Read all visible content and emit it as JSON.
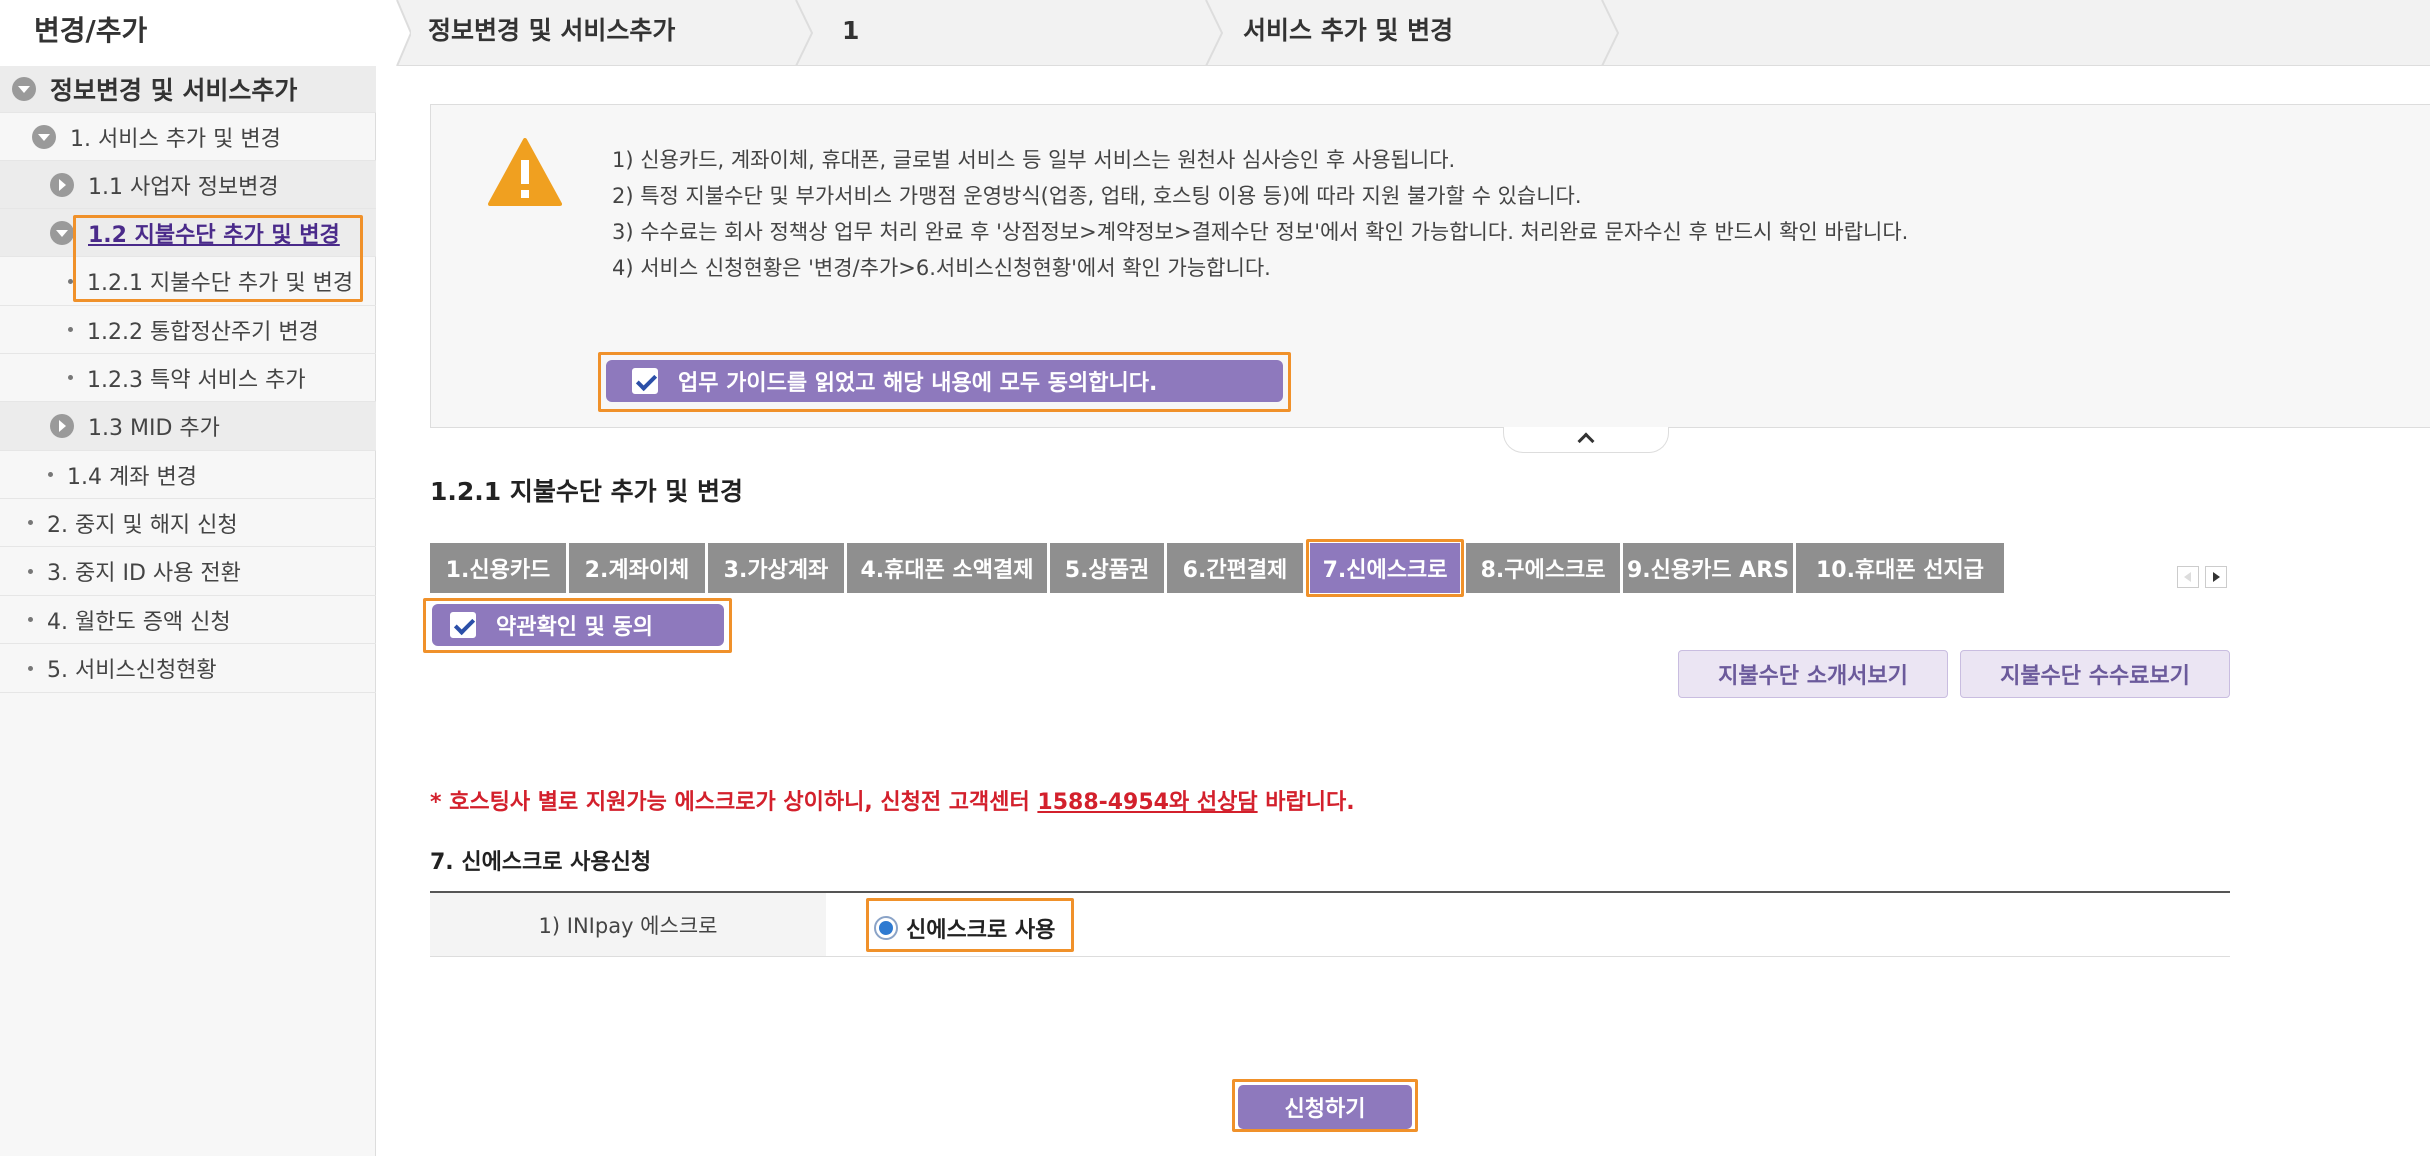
{
  "breadcrumb": {
    "root": "변경/추가",
    "level1": "정보변경 및 서비스추가",
    "level2": "1",
    "level3": "서비스 추가 및 변경"
  },
  "sidebar": {
    "header": "정보변경 및 서비스추가",
    "items": [
      {
        "label": "1. 서비스 추가 및 변경"
      },
      {
        "label": "1.1 사업자 정보변경"
      },
      {
        "label": "1.2 지불수단 추가 및 변경"
      },
      {
        "label": "1.2.1 지불수단 추가 및 변경"
      },
      {
        "label": "1.2.2 통합정산주기 변경"
      },
      {
        "label": "1.2.3 특약 서비스 추가"
      },
      {
        "label": "1.3 MID 추가"
      },
      {
        "label": "1.4 계좌 변경"
      },
      {
        "label": "2. 중지 및 해지 신청"
      },
      {
        "label": "3. 중지 ID 사용 전환"
      },
      {
        "label": "4. 월한도 증액 신청"
      },
      {
        "label": "5. 서비스신청현황"
      }
    ]
  },
  "guide": {
    "lines": [
      "1) 신용카드, 계좌이체, 휴대폰, 글로벌 서비스 등 일부 서비스는 원천사 심사승인 후 사용됩니다.",
      "2) 특정 지불수단 및 부가서비스 가맹점 운영방식(업종, 업태, 호스팅 이용 등)에 따라 지원 불가할 수 있습니다.",
      "3) 수수료는 회사 정책상 업무 처리 완료 후 '상점정보>계약정보>결제수단 정보'에서 확인 가능합니다. 처리완료 문자수신 후 반드시 확인 바랍니다.",
      "4) 서비스 신청현황은 '변경/추가>6.서비스신청현황'에서 확인 가능합니다."
    ],
    "agree_label": "업무 가이드를 읽었고 해당 내용에 모두 동의합니다."
  },
  "section_title": "1.2.1 지불수단 추가 및 변경",
  "tabs": [
    {
      "label": "1.신용카드"
    },
    {
      "label": "2.계좌이체"
    },
    {
      "label": "3.가상계좌"
    },
    {
      "label": "4.휴대폰 소액결제"
    },
    {
      "label": "5.상품권"
    },
    {
      "label": "6.간편결제"
    },
    {
      "label": "7.신에스크로"
    },
    {
      "label": "8.구에스크로"
    },
    {
      "label": "9.신용카드 ARS"
    },
    {
      "label": "10.휴대폰 선지급"
    }
  ],
  "terms_label": "약관확인 및 동의",
  "buttons": {
    "intro": "지불수단 소개서보기",
    "fee": "지불수단 수수료보기",
    "apply": "신청하기"
  },
  "notice": {
    "prefix": "* 호스팅사 별로 지원가능 에스크로가 상이하니, 신청전 고객센터 ",
    "link": "1588-4954와 선상담",
    "suffix": " 바랍니다."
  },
  "form": {
    "title": "7. 신에스크로 사용신청",
    "row_label": "1) INIpay 에스크로",
    "option_label": "신에스크로 사용"
  },
  "colors": {
    "accent": "#8e79bd",
    "highlight": "#f0912a",
    "notice": "#d3202c",
    "tab_default": "#8f8f8f"
  }
}
